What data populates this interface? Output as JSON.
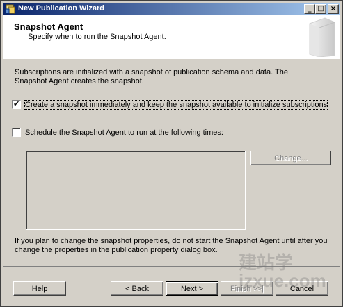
{
  "window": {
    "title": "New Publication Wizard",
    "minimize_glyph": "_",
    "maximize_glyph": "□",
    "close_glyph": "×"
  },
  "header": {
    "title": "Snapshot Agent",
    "subtitle": "Specify when to run the Snapshot Agent."
  },
  "intro_text": "Subscriptions are initialized with a snapshot of publication schema and data. The Snapshot Agent creates the snapshot.",
  "options": {
    "create_snapshot": {
      "label": "Create a snapshot immediately and keep the snapshot available to initialize subscriptions",
      "checked": true,
      "check_glyph": "✔"
    },
    "schedule_agent": {
      "label": "Schedule the Snapshot Agent to run at the following times:",
      "checked": false
    }
  },
  "change_button": {
    "label": "Change..."
  },
  "note_text": "If you plan to change the snapshot properties, do not start the Snapshot Agent until after you change the properties in the publication property dialog box.",
  "footer": {
    "help_label": "Help",
    "back_label": "< Back",
    "next_label": "Next >",
    "finish_label": "Finish >>|",
    "cancel_label": "Cancel"
  },
  "watermark": "建站学 jzxue.com"
}
